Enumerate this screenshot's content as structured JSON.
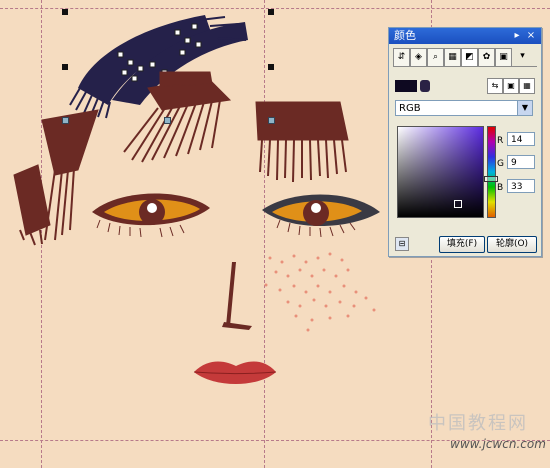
{
  "docker": {
    "title": "颜色",
    "minimize_glyph": "▸",
    "close_glyph": "×",
    "tabs": [
      {
        "icon": "color-eyedropper-icon",
        "glyph": "⇵"
      },
      {
        "icon": "color-mixer-icon",
        "glyph": "◈"
      },
      {
        "icon": "color-viewer-icon",
        "glyph": "⌕"
      },
      {
        "icon": "color-palette-grid-icon",
        "glyph": "▦"
      },
      {
        "icon": "color-models-icon",
        "glyph": "◩"
      },
      {
        "icon": "color-harmony-icon",
        "glyph": "✿"
      },
      {
        "icon": "palette-swatches-icon",
        "glyph": "▣"
      }
    ],
    "more_glyph": "▾",
    "model": "RGB",
    "r_label": "R",
    "g_label": "G",
    "b_label": "B",
    "r_value": "14",
    "g_value": "9",
    "b_value": "33",
    "fill_button": "填充(F)",
    "outline_button": "轮廓(O)",
    "lock_glyph": "⊟",
    "current_color": "#0e0921"
  },
  "watermark": {
    "site_name": "中国教程网",
    "url": "www.jcwcn.com"
  },
  "colors": {
    "canvas": "#f5dcc0",
    "hair": "#6b2a24",
    "selected_hair": "#25214a",
    "eye_iris": "#e09018",
    "lips": "#c43a3a"
  }
}
